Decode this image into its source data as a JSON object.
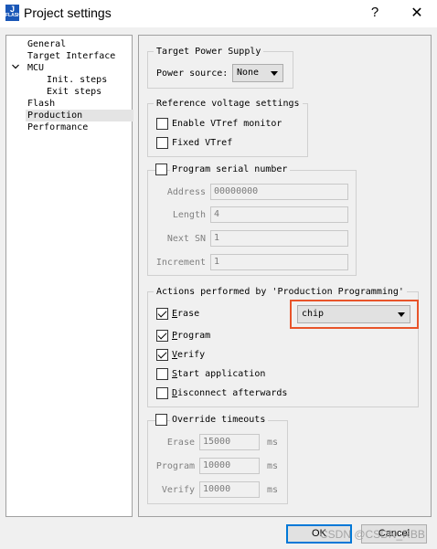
{
  "window": {
    "icon_text": [
      "J",
      "FLASH"
    ],
    "title": "Project settings",
    "help_label": "?",
    "close_label": "✕"
  },
  "tree": {
    "items": [
      {
        "label": "General"
      },
      {
        "label": "Target Interface"
      },
      {
        "label": "MCU",
        "expanded": true
      },
      {
        "label": "Init. steps"
      },
      {
        "label": "Exit steps"
      },
      {
        "label": "Flash"
      },
      {
        "label": "Production",
        "selected": true
      },
      {
        "label": "Performance"
      }
    ]
  },
  "power_supply": {
    "legend": "Target Power Supply",
    "source_label": "Power source:",
    "source_value": "None"
  },
  "vref": {
    "legend": "Reference voltage settings",
    "enable_label": "Enable VTref monitor",
    "enable_checked": false,
    "fixed_label": "Fixed VTref",
    "fixed_checked": false
  },
  "serial": {
    "legend": "Program serial number",
    "checked": false,
    "address_label": "Address",
    "address_value": "00000000",
    "length_label": "Length",
    "length_value": "4",
    "next_label": "Next SN",
    "next_value": "1",
    "increment_label": "Increment",
    "increment_value": "1"
  },
  "actions": {
    "legend": "Actions performed by 'Production Programming'",
    "erase": {
      "key": "E",
      "rest": "rase",
      "checked": true
    },
    "erase_mode": "chip",
    "program": {
      "key": "P",
      "rest": "rogram",
      "checked": true
    },
    "verify": {
      "key": "V",
      "rest": "erify",
      "checked": true
    },
    "start": {
      "key": "S",
      "rest": "tart application",
      "checked": false
    },
    "disconnect": {
      "key": "D",
      "rest": "isconnect afterwards",
      "checked": false
    }
  },
  "timeouts": {
    "legend": "Override timeouts",
    "checked": false,
    "erase_label": "Erase",
    "erase_value": "15000",
    "program_label": "Program",
    "program_value": "10000",
    "verify_label": "Verify",
    "verify_value": "10000",
    "unit": "ms"
  },
  "buttons": {
    "ok": "OK",
    "cancel": "Cancel"
  },
  "watermark": "CSDN @CSDN_RBB",
  "colors": {
    "highlight": "#e8542a",
    "focus": "#0078d7"
  }
}
